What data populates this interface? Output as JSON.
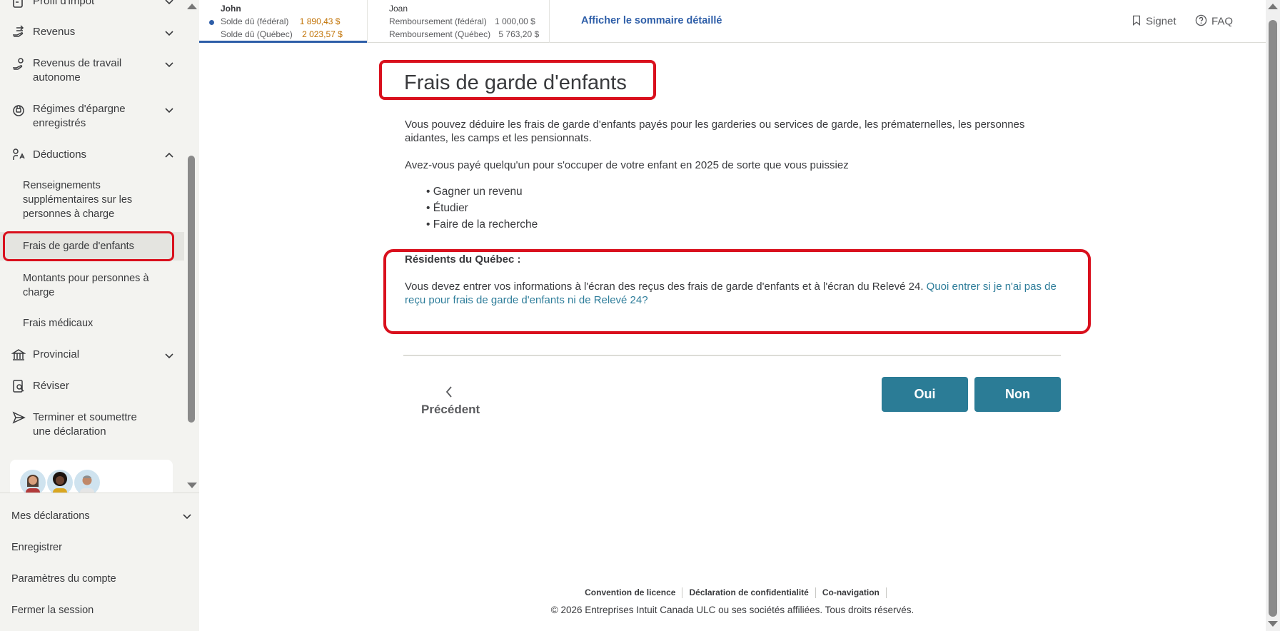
{
  "sidebar": {
    "items": [
      {
        "label": "Profil d'impôt",
        "icon": "profile-icon"
      },
      {
        "label": "Revenus",
        "icon": "income-icon"
      },
      {
        "label": "Revenus de travail autonome",
        "icon": "self-employment-icon"
      },
      {
        "label": "Régimes d'épargne enregistrés",
        "icon": "savings-icon"
      },
      {
        "label": "Déductions",
        "icon": "deductions-icon"
      },
      {
        "label": "Provincial",
        "icon": "provincial-icon"
      },
      {
        "label": "Réviser",
        "icon": "review-icon"
      },
      {
        "label": "Terminer et soumettre une déclaration",
        "icon": "send-icon"
      }
    ],
    "sub_items": [
      {
        "label": "Renseignements supplémentaires sur les personnes à charge"
      },
      {
        "label": "Frais de garde d'enfants"
      },
      {
        "label": "Montants pour personnes à charge"
      },
      {
        "label": "Frais médicaux"
      }
    ],
    "bottom": [
      {
        "label": "Mes déclarations"
      },
      {
        "label": "Enregistrer"
      },
      {
        "label": "Paramètres du compte"
      },
      {
        "label": "Fermer la session"
      }
    ]
  },
  "header": {
    "john": {
      "name": "John",
      "row1_label": "Solde dû (fédéral)",
      "row1_value": "1 890,43  $",
      "row2_label": "Solde dû (Québec)",
      "row2_value": "2 023,57  $"
    },
    "joan": {
      "name": "Joan",
      "row1_label": "Remboursement (fédéral)",
      "row1_value": "1 000,00  $",
      "row2_label": "Remboursement (Québec)",
      "row2_value": "5 763,20  $"
    },
    "summary_link": "Afficher le sommaire détaillé",
    "bookmark": "Signet",
    "faq": "FAQ"
  },
  "main": {
    "title": "Frais de garde d'enfants",
    "intro": "Vous pouvez déduire les frais de garde d'enfants payés pour les garderies ou services de garde, les prématernelles, les personnes aidantes, les camps et les pensionnats.",
    "question": "Avez-vous payé quelqu'un pour s'occuper de votre enfant en 2025 de sorte que vous puissiez",
    "bullets": [
      "Gagner un revenu",
      "Étudier",
      "Faire de la recherche"
    ],
    "quebec_title": "Résidents du Québec :",
    "quebec_text": "Vous devez entrer vos informations à l'écran des reçus des frais de garde d'enfants et à l'écran du Relevé 24. ",
    "quebec_link": "Quoi entrer si je n'ai pas de reçu pour frais de garde d'enfants ni de Relevé 24?",
    "prev": "Précédent",
    "yes": "Oui",
    "no": "Non"
  },
  "footer": {
    "links": [
      "Convention de licence",
      "Déclaration de confidentialité",
      "Co-navigation"
    ],
    "copyright": "© 2026 Entreprises Intuit Canada ULC ou ses sociétés affiliées. Tous droits réservés."
  },
  "colors": {
    "accent": "#2b7c96",
    "link": "#2e5ea8",
    "highlight": "#d9101d",
    "amount_due": "#c07000"
  }
}
